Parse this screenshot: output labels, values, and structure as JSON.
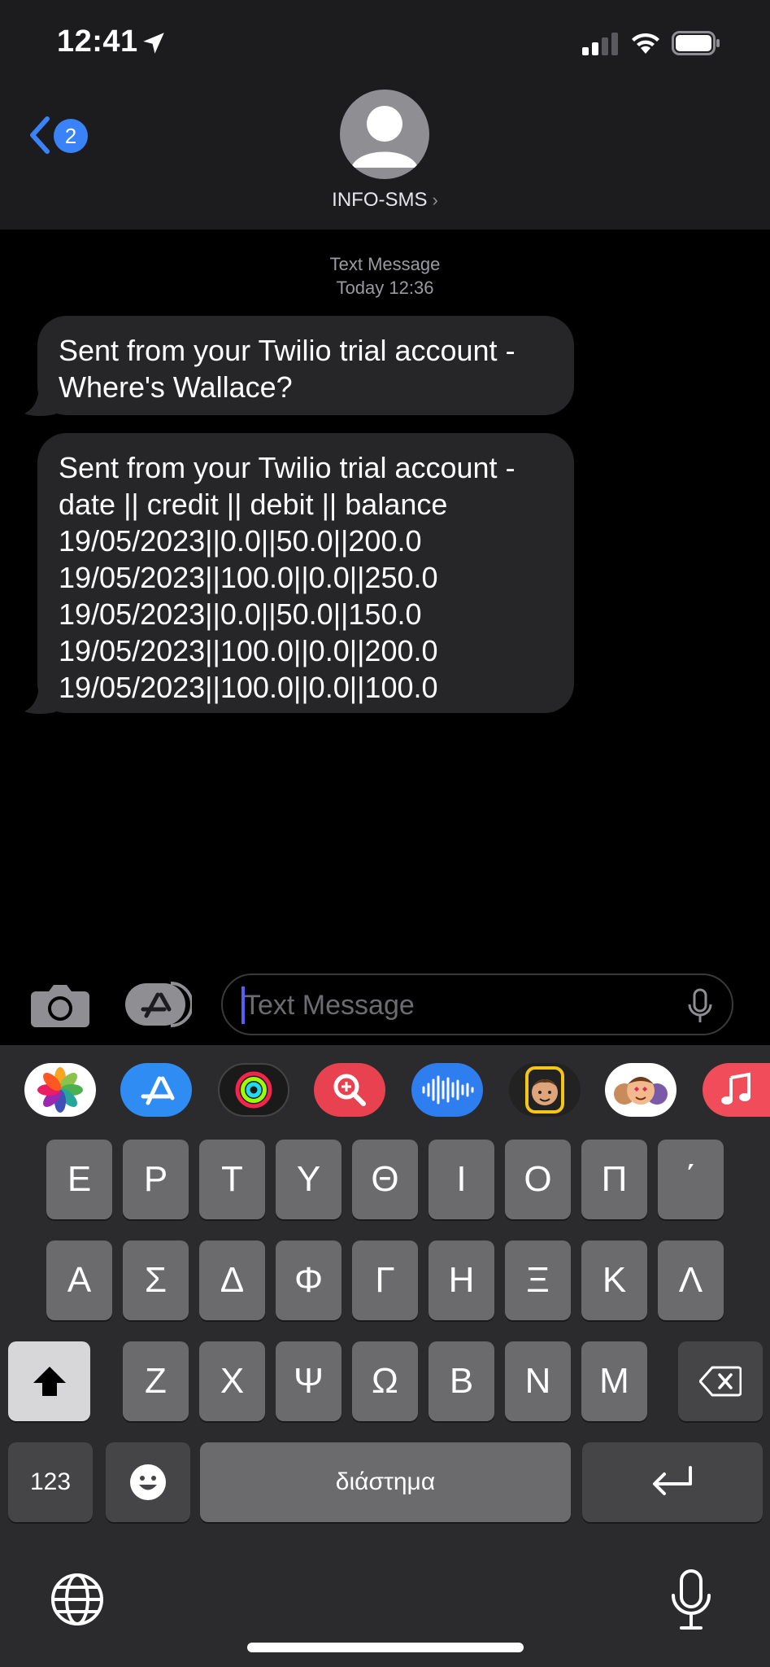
{
  "status_bar": {
    "time": "12:41"
  },
  "header": {
    "back_badge_count": "2",
    "contact_name": "INFO-SMS",
    "contact_chevron": "›"
  },
  "conversation": {
    "service_label": "Text Message",
    "timestamp": "Today 12:36",
    "messages": [
      {
        "lines": [
          "Sent from your Twilio trial account -",
          "Where's Wallace?"
        ]
      },
      {
        "lines": [
          "Sent from your Twilio trial account -",
          "date || credit  || debit  || balance",
          "19/05/2023||0.0||50.0||200.0",
          "19/05/2023||100.0||0.0||250.0",
          "19/05/2023||0.0||50.0||150.0",
          "19/05/2023||100.0||0.0||200.0",
          "19/05/2023||100.0||0.0||100.0"
        ]
      }
    ]
  },
  "composer": {
    "placeholder": "Text Message"
  },
  "app_strip": [
    "photos-icon",
    "app-store-icon",
    "activity-icon",
    "search-images-icon",
    "audio-message-icon",
    "memoji-icon",
    "memoji-stickers-icon",
    "music-icon"
  ],
  "keyboard": {
    "row1": [
      "Ε",
      "Ρ",
      "Τ",
      "Υ",
      "Θ",
      "Ι",
      "Ο",
      "Π",
      "΄"
    ],
    "row2": [
      "Α",
      "Σ",
      "Δ",
      "Φ",
      "Γ",
      "Η",
      "Ξ",
      "Κ",
      "Λ"
    ],
    "row3": [
      "Ζ",
      "Χ",
      "Ψ",
      "Ω",
      "Β",
      "Ν",
      "Μ"
    ],
    "numbers_label": "123",
    "space_label": "διάστημα"
  }
}
